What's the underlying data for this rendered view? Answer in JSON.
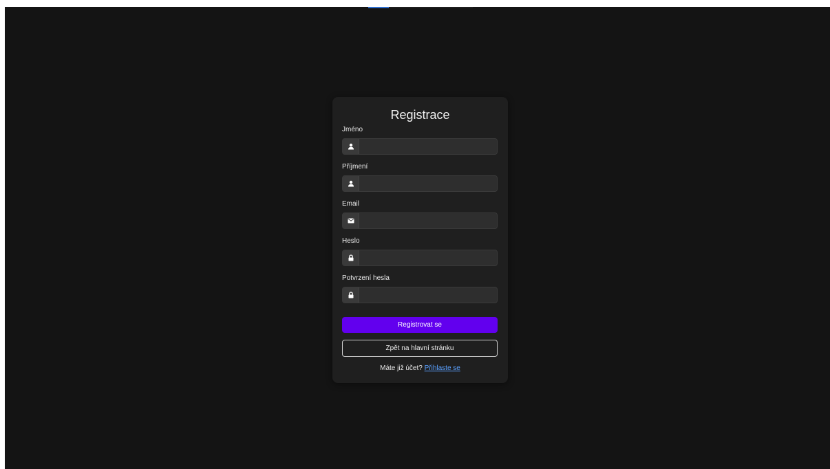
{
  "form": {
    "title": "Registrace",
    "fields": [
      {
        "label": "Jméno",
        "icon": "user-icon",
        "type": "text",
        "value": "",
        "placeholder": ""
      },
      {
        "label": "Příjmení",
        "icon": "user-icon",
        "type": "text",
        "value": "",
        "placeholder": ""
      },
      {
        "label": "Email",
        "icon": "envelope-icon",
        "type": "email",
        "value": "",
        "placeholder": ""
      },
      {
        "label": "Heslo",
        "icon": "lock-icon",
        "type": "password",
        "value": "",
        "placeholder": ""
      },
      {
        "label": "Potvrzení hesla",
        "icon": "lock-icon",
        "type": "password",
        "value": "",
        "placeholder": ""
      }
    ],
    "register_button": "Registrovat se",
    "back_button": "Zpět na hlavní stránku",
    "footer_prompt": "Máte již účet?",
    "login_link": "Přihlaste se"
  },
  "colors": {
    "background": "#141414",
    "card": "#1f1f1f",
    "input": "#2e2e2e",
    "primary": "#6200ee",
    "link": "#5aa0ff"
  }
}
